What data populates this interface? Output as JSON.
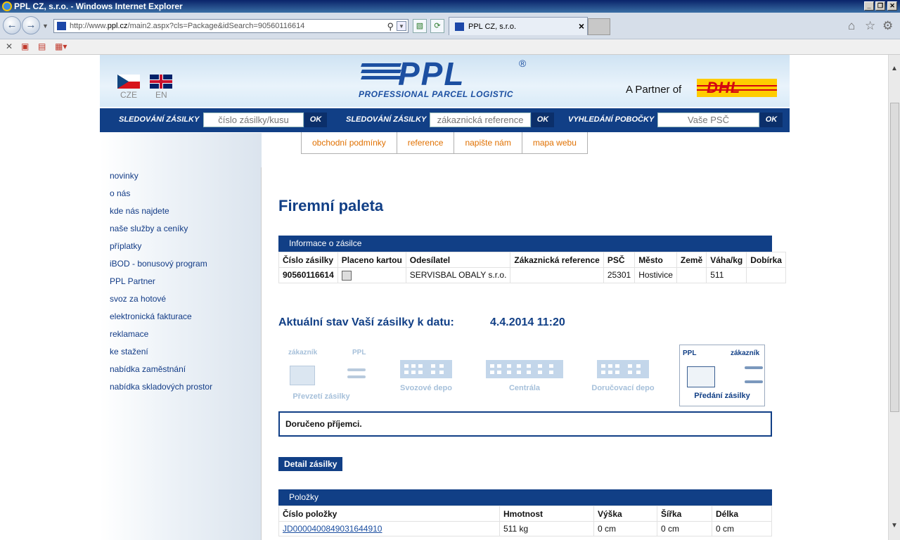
{
  "browser": {
    "window_title": "PPL CZ, s.r.o. - Windows Internet Explorer",
    "url_prefix": "http://www.",
    "url_domain": "ppl.cz",
    "url_path": "/main2.aspx?cls=Package&idSearch=90560116614",
    "tab_title": "PPL CZ, s.r.o.",
    "tab_close": "×"
  },
  "header": {
    "lang_cz": "CZE",
    "lang_en": "EN",
    "logo_text": "PPL",
    "logo_registered": "®",
    "logo_subtitle": "PROFESSIONAL PARCEL LOGISTIC",
    "partner_text": "A Partner of",
    "partner_logo": "DHL"
  },
  "searchbar": {
    "track1_label": "SLEDOVÁNÍ ZÁSILKY",
    "track1_placeholder": "číslo zásilky/kusu",
    "track2_label": "SLEDOVÁNÍ ZÁSILKY",
    "track2_placeholder": "zákaznická reference",
    "branch_label": "VYHLEDÁNÍ POBOČKY",
    "branch_placeholder": "Vaše PSČ",
    "ok": "OK"
  },
  "topmenu": [
    "obchodní podmínky",
    "reference",
    "napište nám",
    "mapa webu"
  ],
  "sidebar": {
    "items": [
      "novinky",
      "o nás",
      "kde nás najdete",
      "naše služby a ceníky",
      "příplatky",
      "iBOD - bonusový program",
      "PPL Partner",
      "svoz za hotové",
      "elektronická fakturace",
      "reklamace",
      "ke stažení",
      "nabídka zaměstnání",
      "nabídka skladových prostor"
    ]
  },
  "main": {
    "title": "Firemní paleta",
    "info_section": "Informace o zásilce",
    "info_headers": [
      "Číslo zásilky",
      "Placeno kartou",
      "Odesílatel",
      "Zákaznická reference",
      "PSČ",
      "Město",
      "Země",
      "Váha/kg",
      "Dobírka"
    ],
    "info_row": {
      "shipment_no": "90560116614",
      "sender": "SERVISBAL OBALY s.r.o.",
      "reference": "",
      "psc": "25301",
      "city": "Hostivice",
      "country": "",
      "weight": "511",
      "cod": ""
    },
    "status_title": "Aktuální stav Vaší zásilky k datu:",
    "status_date": "4.4.2014 11:20",
    "tracker": {
      "stage1_left": "zákazník",
      "stage1_right": "PPL",
      "stage1_caption": "Převzetí zásilky",
      "stage2_caption": "Svozové depo",
      "stage3_caption": "Centrála",
      "stage4_caption": "Doručovací depo",
      "stage5_left": "PPL",
      "stage5_right": "zákazník",
      "stage5_caption": "Předání zásilky",
      "active_stage": 5
    },
    "delivered_text": "Doručeno příjemci.",
    "detail_button": "Detail zásilky",
    "items_section": "Položky",
    "items_headers": [
      "Číslo položky",
      "Hmotnost",
      "Výška",
      "Šířka",
      "Délka"
    ],
    "items_rows": [
      {
        "item_no": "JD0000400849031644910",
        "weight": "511 kg",
        "height": "0 cm",
        "width": "0 cm",
        "length": "0 cm"
      }
    ]
  }
}
